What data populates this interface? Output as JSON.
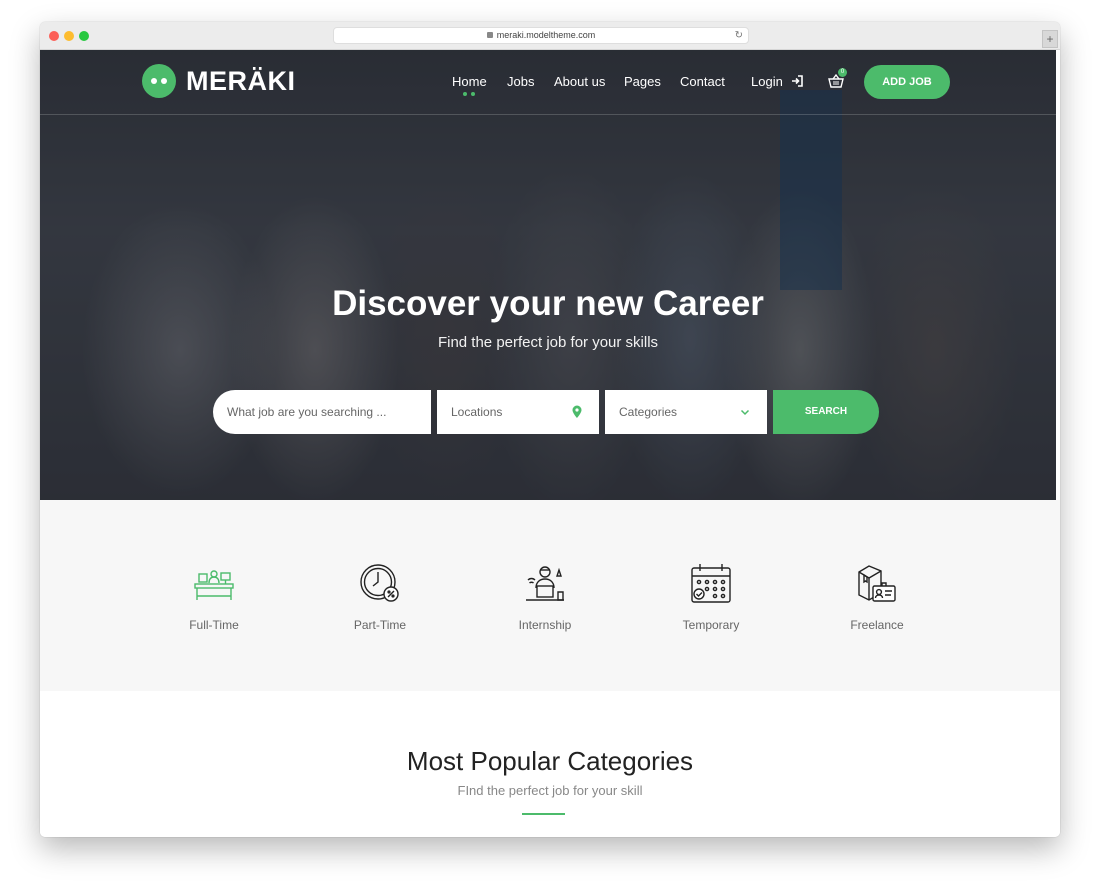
{
  "browser": {
    "url": "meraki.modeltheme.com"
  },
  "header": {
    "logo_text": "MERÄKI",
    "nav": [
      {
        "label": "Home",
        "active": true
      },
      {
        "label": "Jobs"
      },
      {
        "label": "About us"
      },
      {
        "label": "Pages"
      },
      {
        "label": "Contact"
      }
    ],
    "login_label": "Login",
    "cart_count": "0",
    "add_job_label": "ADD JOB"
  },
  "hero": {
    "title": "Discover your new Career",
    "subtitle": "Find the perfect job for your skills",
    "search": {
      "job_placeholder": "What job are you searching ...",
      "location_placeholder": "Locations",
      "category_value": "Categories",
      "button_label": "SEARCH"
    }
  },
  "job_types": [
    {
      "label": "Full-Time",
      "icon": "desk-icon",
      "color": "#4cbb6b"
    },
    {
      "label": "Part-Time",
      "icon": "clock-percent-icon"
    },
    {
      "label": "Internship",
      "icon": "intern-laptop-icon"
    },
    {
      "label": "Temporary",
      "icon": "calendar-check-icon"
    },
    {
      "label": "Freelance",
      "icon": "freelance-badge-icon"
    }
  ],
  "popular": {
    "title": "Most Popular Categories",
    "subtitle": "FInd the perfect job for your skill"
  },
  "colors": {
    "accent": "#4cbb6b",
    "text_dark": "#222222",
    "text_muted": "#666666"
  }
}
